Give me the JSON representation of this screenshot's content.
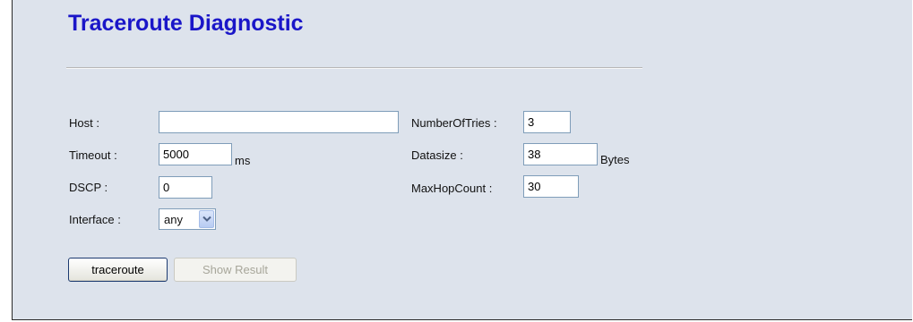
{
  "page": {
    "title": "Traceroute Diagnostic"
  },
  "form": {
    "host": {
      "label": "Host :",
      "value": ""
    },
    "timeout": {
      "label": "Timeout :",
      "value": "5000",
      "unit": "ms"
    },
    "dscp": {
      "label": "DSCP :",
      "value": "0"
    },
    "interface": {
      "label": "Interface :",
      "selected": "any"
    },
    "number_of_tries": {
      "label": "NumberOfTries :",
      "value": "3"
    },
    "datasize": {
      "label": "Datasize :",
      "value": "38",
      "unit": "Bytes"
    },
    "max_hop_count": {
      "label": "MaxHopCount :",
      "value": "30"
    }
  },
  "buttons": {
    "traceroute": "traceroute",
    "show_result": "Show Result"
  },
  "icons": {
    "select_arrow": "chevron-down-icon"
  },
  "colors": {
    "title": "#1a16c8",
    "panel_background": "#dde3ec",
    "input_border": "#7f9db9",
    "disabled_text": "#a7a69a"
  }
}
